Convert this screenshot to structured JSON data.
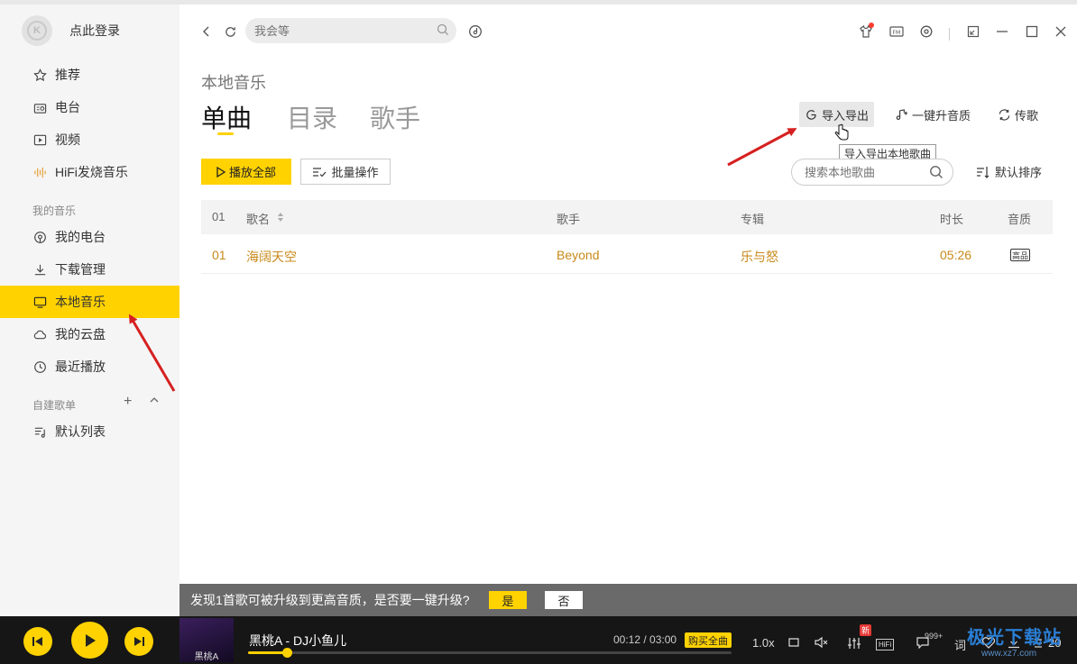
{
  "sidebar": {
    "login": "点此登录",
    "items": [
      {
        "label": "推荐",
        "icon": "star-icon"
      },
      {
        "label": "电台",
        "icon": "radio-icon"
      },
      {
        "label": "视频",
        "icon": "video-icon"
      },
      {
        "label": "HiFi发烧音乐",
        "icon": "waveform-icon"
      }
    ],
    "my_music_title": "我的音乐",
    "my_music": [
      {
        "label": "我的电台",
        "icon": "podcast-icon"
      },
      {
        "label": "下载管理",
        "icon": "download-icon"
      },
      {
        "label": "本地音乐",
        "icon": "monitor-icon",
        "active": true
      },
      {
        "label": "我的云盘",
        "icon": "cloud-icon"
      },
      {
        "label": "最近播放",
        "icon": "clock-icon"
      }
    ],
    "playlist_title": "自建歌单",
    "playlists": [
      {
        "label": "默认列表",
        "icon": "playlist-icon"
      }
    ]
  },
  "topbar": {
    "search_placeholder": "我会等"
  },
  "main": {
    "subtitle": "本地音乐",
    "tabs": [
      {
        "label": "单曲",
        "active": true
      },
      {
        "label": "目录",
        "active": false
      },
      {
        "label": "歌手",
        "active": false
      }
    ],
    "actions": {
      "import_export": "导入导出",
      "upgrade_quality": "一键升音质",
      "transfer": "传歌"
    },
    "tooltip": "导入导出本地歌曲",
    "play_all": "播放全部",
    "batch": "批量操作",
    "local_search_placeholder": "搜索本地歌曲",
    "sort": "默认排序",
    "table": {
      "headers": {
        "index": "01",
        "name": "歌名",
        "artist": "歌手",
        "album": "专辑",
        "duration": "时长",
        "quality": "音质"
      },
      "rows": [
        {
          "index": "01",
          "name": "海阔天空",
          "artist": "Beyond",
          "album": "乐与怒",
          "duration": "05:26",
          "quality": "高品"
        }
      ]
    }
  },
  "banner": {
    "text": "发现1首歌可被升级到更高音质，是否要一键升级?",
    "yes": "是",
    "no": "否"
  },
  "player": {
    "cover_text": "黑桃A",
    "track": "黑桃A - DJ小鱼儿",
    "time": "00:12 / 03:00",
    "buy": "购买全曲",
    "speed": "1.0x",
    "new_badge": "新",
    "hifi": "HiFi",
    "comment_count": "999+",
    "lyric": "词",
    "playlist_count": "20",
    "progress": 0.08
  },
  "watermark": {
    "main": "极光下载站",
    "sub": "www.xz7.com"
  },
  "colors": {
    "accent": "#ffd200",
    "song_text": "#c8891a",
    "arrow": "#d62020"
  }
}
